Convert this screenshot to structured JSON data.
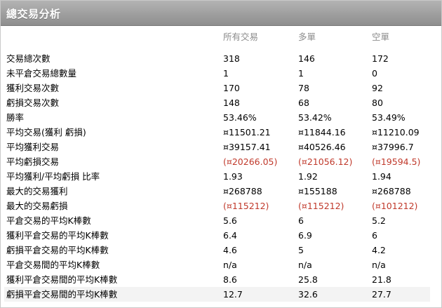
{
  "window": {
    "title": "總交易分析"
  },
  "columns": [
    "",
    "所有交易",
    "多單",
    "空單"
  ],
  "colors": {
    "negative": "#c0392b",
    "header": "#8c8c8c"
  },
  "rows": [
    {
      "label": "交易總次數",
      "all": "318",
      "long": "146",
      "short": "172",
      "neg": false
    },
    {
      "label": "未平倉交易總數量",
      "all": "1",
      "long": "1",
      "short": "0",
      "neg": false
    },
    {
      "label": "獲利交易次數",
      "all": "170",
      "long": "78",
      "short": "92",
      "neg": false
    },
    {
      "label": "虧損交易次數",
      "all": "148",
      "long": "68",
      "short": "80",
      "neg": false
    },
    {
      "label": "勝率",
      "all": "53.46%",
      "long": "53.42%",
      "short": "53.49%",
      "neg": false
    },
    {
      "label": "平均交易(獲利 虧損)",
      "all": "¤11501.21",
      "long": "¤11844.16",
      "short": "¤11210.09",
      "neg": false
    },
    {
      "label": "平均獲利交易",
      "all": "¤39157.41",
      "long": "¤40526.46",
      "short": "¤37996.7",
      "neg": false
    },
    {
      "label": "平均虧損交易",
      "all": "(¤20266.05)",
      "long": "(¤21056.12)",
      "short": "(¤19594.5)",
      "neg": true
    },
    {
      "label": "平均獲利/平均虧損 比率",
      "all": "1.93",
      "long": "1.92",
      "short": "1.94",
      "neg": false
    },
    {
      "label": "最大的交易獲利",
      "all": "¤268788",
      "long": "¤155188",
      "short": "¤268788",
      "neg": false
    },
    {
      "label": "最大的交易虧損",
      "all": "(¤115212)",
      "long": "(¤115212)",
      "short": "(¤101212)",
      "neg": true
    },
    {
      "label": "平倉交易的平均K棒數",
      "all": "5.6",
      "long": "6",
      "short": "5.2",
      "neg": false
    },
    {
      "label": "獲利平倉交易的平均K棒數",
      "all": "6.4",
      "long": "6.9",
      "short": "6",
      "neg": false
    },
    {
      "label": "虧損平倉交易的平均K棒數",
      "all": "4.6",
      "long": "5",
      "short": "4.2",
      "neg": false
    },
    {
      "label": "平倉交易間的平均K棒數",
      "all": "n/a",
      "long": "n/a",
      "short": "n/a",
      "neg": false
    },
    {
      "label": "獲利平倉交易間的平均K棒數",
      "all": "8.6",
      "long": "25.8",
      "short": "21.8",
      "neg": false
    },
    {
      "label": "虧損平倉交易間的平均K棒數",
      "all": "12.7",
      "long": "32.6",
      "short": "27.7",
      "neg": false
    }
  ]
}
